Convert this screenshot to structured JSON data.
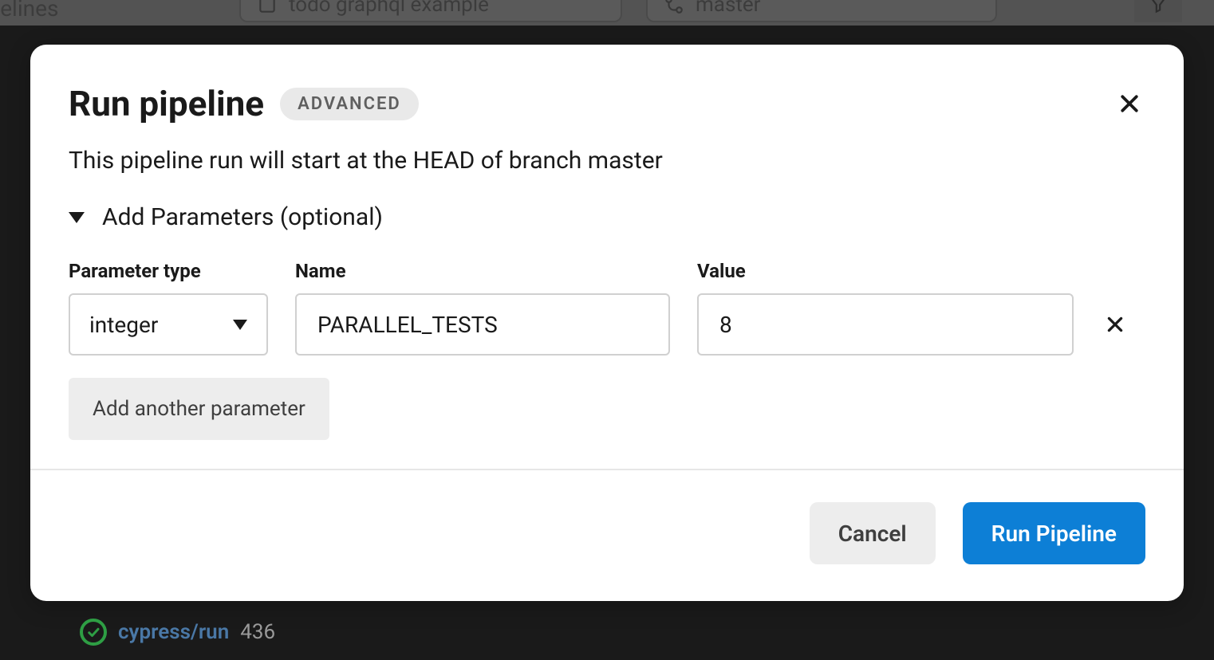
{
  "background": {
    "context_label": "Pipelines",
    "project_chip": "todo graphql example",
    "branch_chip": "master",
    "peek_job": "cypress/run",
    "peek_number": "436"
  },
  "modal": {
    "title": "Run pipeline",
    "badge": "ADVANCED",
    "subtitle": "This pipeline run will start at the HEAD of branch master",
    "section_toggle": "Add Parameters (optional)",
    "columns": {
      "type": "Parameter type",
      "name": "Name",
      "value": "Value"
    },
    "parameters": [
      {
        "type": "integer",
        "name": "PARALLEL_TESTS",
        "value": "8"
      }
    ],
    "add_another_label": "Add another parameter",
    "cancel_label": "Cancel",
    "run_label": "Run Pipeline"
  }
}
